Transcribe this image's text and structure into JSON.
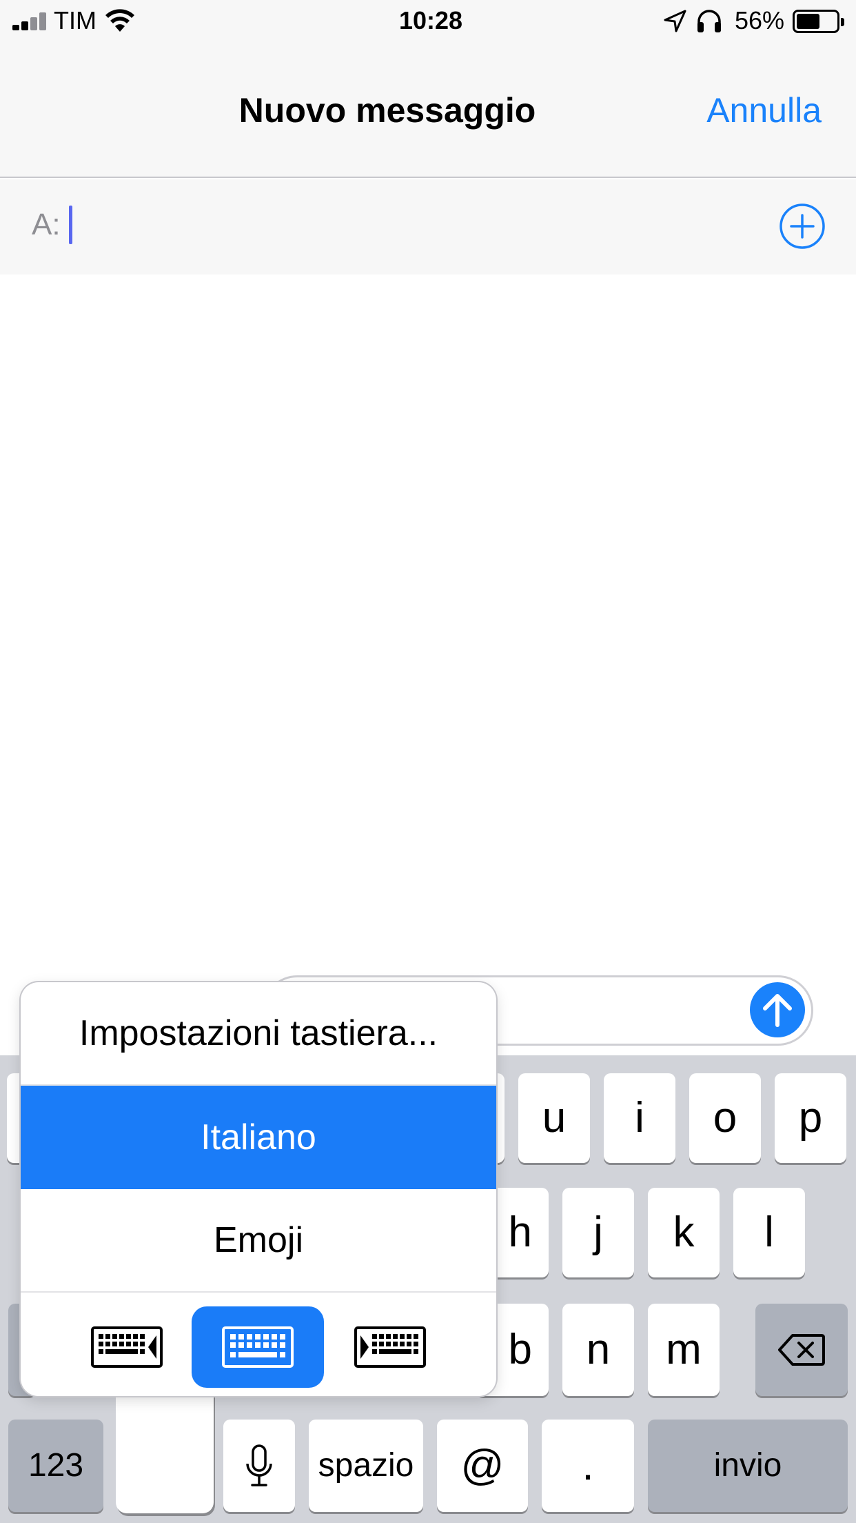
{
  "status_bar": {
    "carrier": "TIM",
    "time": "10:28",
    "battery_percent": "56%",
    "battery_level": 0.56,
    "icons": [
      "signal-icon",
      "wifi-icon",
      "location-arrow-icon",
      "headphones-icon",
      "battery-icon"
    ]
  },
  "nav": {
    "title": "Nuovo messaggio",
    "cancel_label": "Annulla"
  },
  "recipient": {
    "label": "A:",
    "value": ""
  },
  "compose": {
    "value": "",
    "send_icon": "arrow-up-icon"
  },
  "keyboard_popup": {
    "settings_label": "Impostazioni tastiera...",
    "selected_language": "Italiano",
    "emoji_label": "Emoji",
    "layouts": [
      "keyboard-left-icon",
      "keyboard-full-icon",
      "keyboard-right-icon"
    ],
    "active_layout": "keyboard-full-icon"
  },
  "keyboard": {
    "row1": [
      "u",
      "i",
      "o",
      "p"
    ],
    "row2": [
      "h",
      "j",
      "k",
      "l"
    ],
    "row3": [
      "b",
      "n",
      "m"
    ],
    "numbers_label": "123",
    "space_label": "spazio",
    "at_label": "@",
    "dot_label": ".",
    "return_label": "invio",
    "backspace_icon": "backspace-icon",
    "mic_icon": "microphone-icon"
  },
  "colors": {
    "accent": "#1a82fb",
    "selected": "#1a7cf8",
    "keyboard_bg": "#d1d3d9",
    "caret": "#5967f0"
  }
}
